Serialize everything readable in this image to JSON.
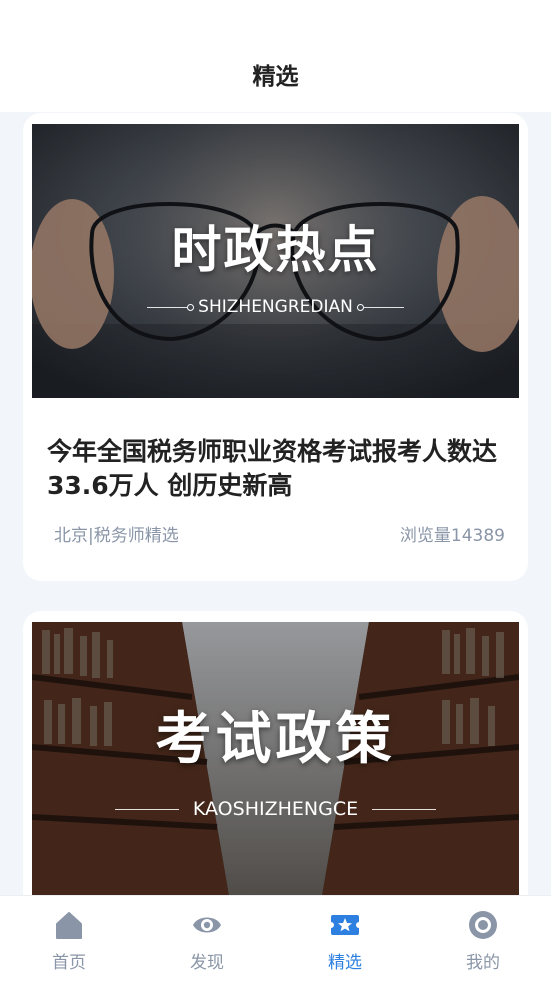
{
  "header": {
    "title": "精选"
  },
  "cards": [
    {
      "banner": {
        "title": "时政热点",
        "subtitle": "SHIZHENGREDIAN"
      },
      "title": "今年全国税务师职业资格考试报考人数达33.6万人 创历史新高",
      "source": "北京|税务师精选",
      "views": "浏览量14389"
    },
    {
      "banner": {
        "title": "考试政策",
        "subtitle": "KAOSHIZHENGCE"
      }
    }
  ],
  "tabbar": {
    "items": [
      {
        "label": "首页",
        "icon": "home-icon"
      },
      {
        "label": "发现",
        "icon": "eye-icon"
      },
      {
        "label": "精选",
        "icon": "star-ticket-icon"
      },
      {
        "label": "我的",
        "icon": "profile-ring-icon"
      }
    ],
    "active_index": 2,
    "active_color": "#2d7fe0",
    "inactive_color": "#8a96a8"
  }
}
